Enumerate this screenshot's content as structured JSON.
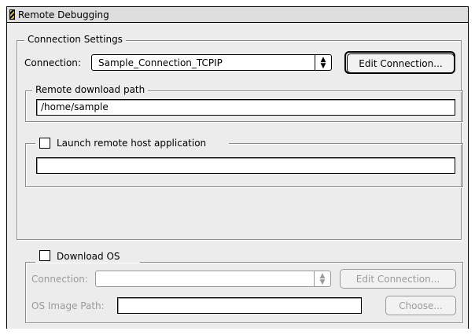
{
  "window": {
    "title": "Remote Debugging"
  },
  "connection_settings": {
    "legend": "Connection Settings",
    "connection_label": "Connection:",
    "connection_value": "Sample_Connection_TCPIP",
    "edit_connection_label": "Edit Connection...",
    "remote_download": {
      "legend": "Remote download path",
      "path_value": "/home/sample"
    },
    "launch_remote": {
      "label": "Launch remote host application",
      "checked": false,
      "value": ""
    }
  },
  "download_os": {
    "label": "Download OS",
    "checked": false,
    "connection_label": "Connection:",
    "connection_value": "",
    "edit_connection_label": "Edit Connection...",
    "os_image_path_label": "OS Image Path:",
    "os_image_path_value": "",
    "choose_label": "Choose..."
  },
  "icons": {
    "window_icon": "striped-window-icon",
    "popup_arrow": "up-down-arrows-icon"
  }
}
